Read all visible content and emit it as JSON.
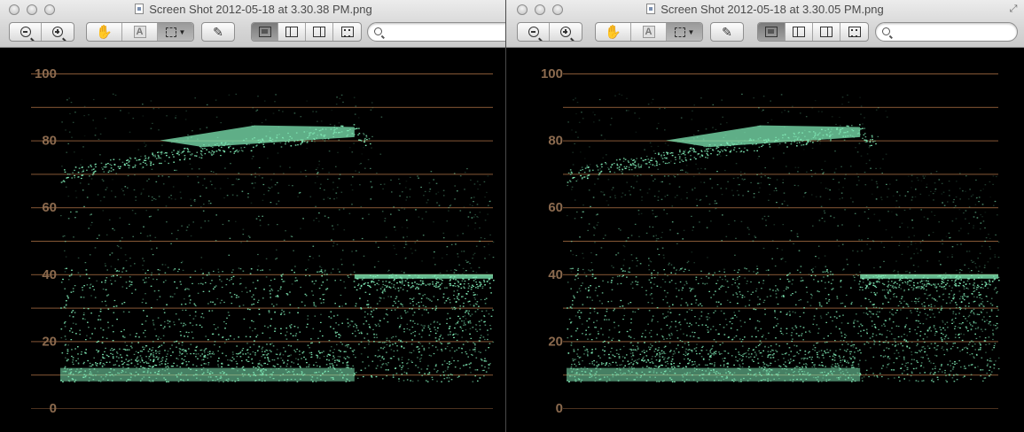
{
  "windows": [
    {
      "id": "left",
      "title": "Screen Shot 2012-05-18 at 3.30.38 PM.png",
      "search": {
        "value": "",
        "placeholder": ""
      }
    },
    {
      "id": "right",
      "title": "Screen Shot 2012-05-18 at 3.30.05 PM.png",
      "search": {
        "value": "",
        "placeholder": ""
      }
    }
  ],
  "toolbar": {
    "zoom_out_icon": "zoom-out-icon",
    "zoom_in_icon": "zoom-in-icon",
    "move_icon": "hand-icon",
    "text_icon": "text-select-icon",
    "select_icon": "rect-select-icon",
    "annotate_icon": "pencil-icon",
    "view_icons": [
      "content-only-icon",
      "thumbnails-icon",
      "table-of-contents-icon",
      "contact-sheet-icon"
    ]
  },
  "waveform": {
    "y_axis_labels": [
      "100",
      "80",
      "60",
      "40",
      "20",
      "0"
    ],
    "gridline_color": "#a86e44",
    "label_color": "#8b6a4e",
    "trace_color": "#7fe8b4"
  }
}
